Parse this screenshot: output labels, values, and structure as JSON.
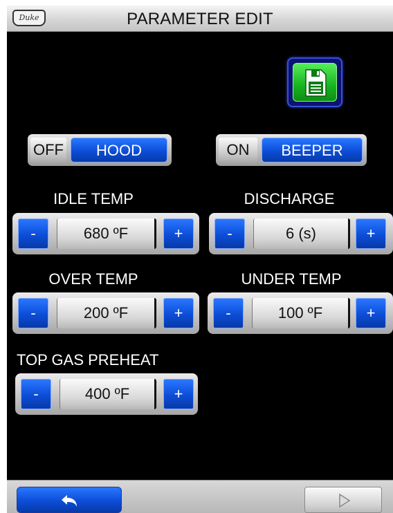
{
  "header": {
    "title": "PARAMETER EDIT",
    "logo_text": "Duke"
  },
  "toolbar": {
    "save_icon": "floppy-disk-icon"
  },
  "toggles": {
    "hood": {
      "state_text": "OFF",
      "name": "HOOD"
    },
    "beeper": {
      "state_text": "ON",
      "name": "BEEPER"
    }
  },
  "params": {
    "idle_temp": {
      "label": "IDLE TEMP",
      "value": "680 ºF"
    },
    "discharge": {
      "label": "DISCHARGE",
      "value": "6 (s)"
    },
    "over_temp": {
      "label": "OVER TEMP",
      "value": "200 ºF"
    },
    "under_temp": {
      "label": "UNDER TEMP",
      "value": "100 ºF"
    },
    "top_gas_preheat": {
      "label": "TOP GAS PREHEAT",
      "value": "400 ºF"
    }
  },
  "stepper": {
    "minus": "-",
    "plus": "+"
  },
  "footer": {
    "back_icon": "back-arrow-icon",
    "next_icon": "next-arrow-icon"
  }
}
